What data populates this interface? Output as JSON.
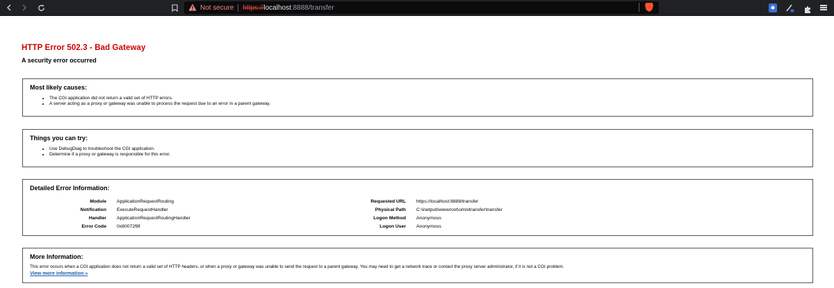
{
  "browser": {
    "not_secure_label": "Not secure",
    "url_scheme": "https://",
    "url_host": "localhost",
    "url_rest": ":8888/transfer",
    "colors": {
      "chrome_bg": "#202124",
      "warning": "#f28b82",
      "brave": "#fb542b"
    }
  },
  "error": {
    "title": "HTTP Error 502.3 - Bad Gateway",
    "subtitle": "A security error occurred"
  },
  "causes": {
    "heading": "Most likely causes:",
    "items": [
      "The CGI application did not return a valid set of HTTP errors.",
      "A server acting as a proxy or gateway was unable to process the request due to an error in a parent gateway."
    ]
  },
  "try": {
    "heading": "Things you can try:",
    "items": [
      "Use DebugDiag to troubleshoot the CGI application.",
      "Determine if a proxy or gateway is responsible for this error."
    ]
  },
  "detail": {
    "heading": "Detailed Error Information:",
    "left": [
      {
        "key": "Module",
        "value": "ApplicationRequestRouting"
      },
      {
        "key": "Notification",
        "value": "ExecuteRequestHandler"
      },
      {
        "key": "Handler",
        "value": "ApplicationRequestRoutingHandler"
      },
      {
        "key": "Error Code",
        "value": "0x80072f8f"
      }
    ],
    "right": [
      {
        "key": "Requested URL",
        "value": "https://localhost:8888/transfer"
      },
      {
        "key": "Physical Path",
        "value": "C:\\inetpub\\wwwroot\\omnitransfer\\transfer"
      },
      {
        "key": "Logon Method",
        "value": "Anonymous"
      },
      {
        "key": "Logon User",
        "value": "Anonymous"
      }
    ]
  },
  "more": {
    "heading": "More Information:",
    "text": "This error occurs when a CGI application does not return a valid set of HTTP headers, or when a proxy or gateway was unable to send the request to a parent gateway. You may need to get a network trace or contact the proxy server administrator, if it is not a CGI problem.",
    "link": "View more information »"
  }
}
